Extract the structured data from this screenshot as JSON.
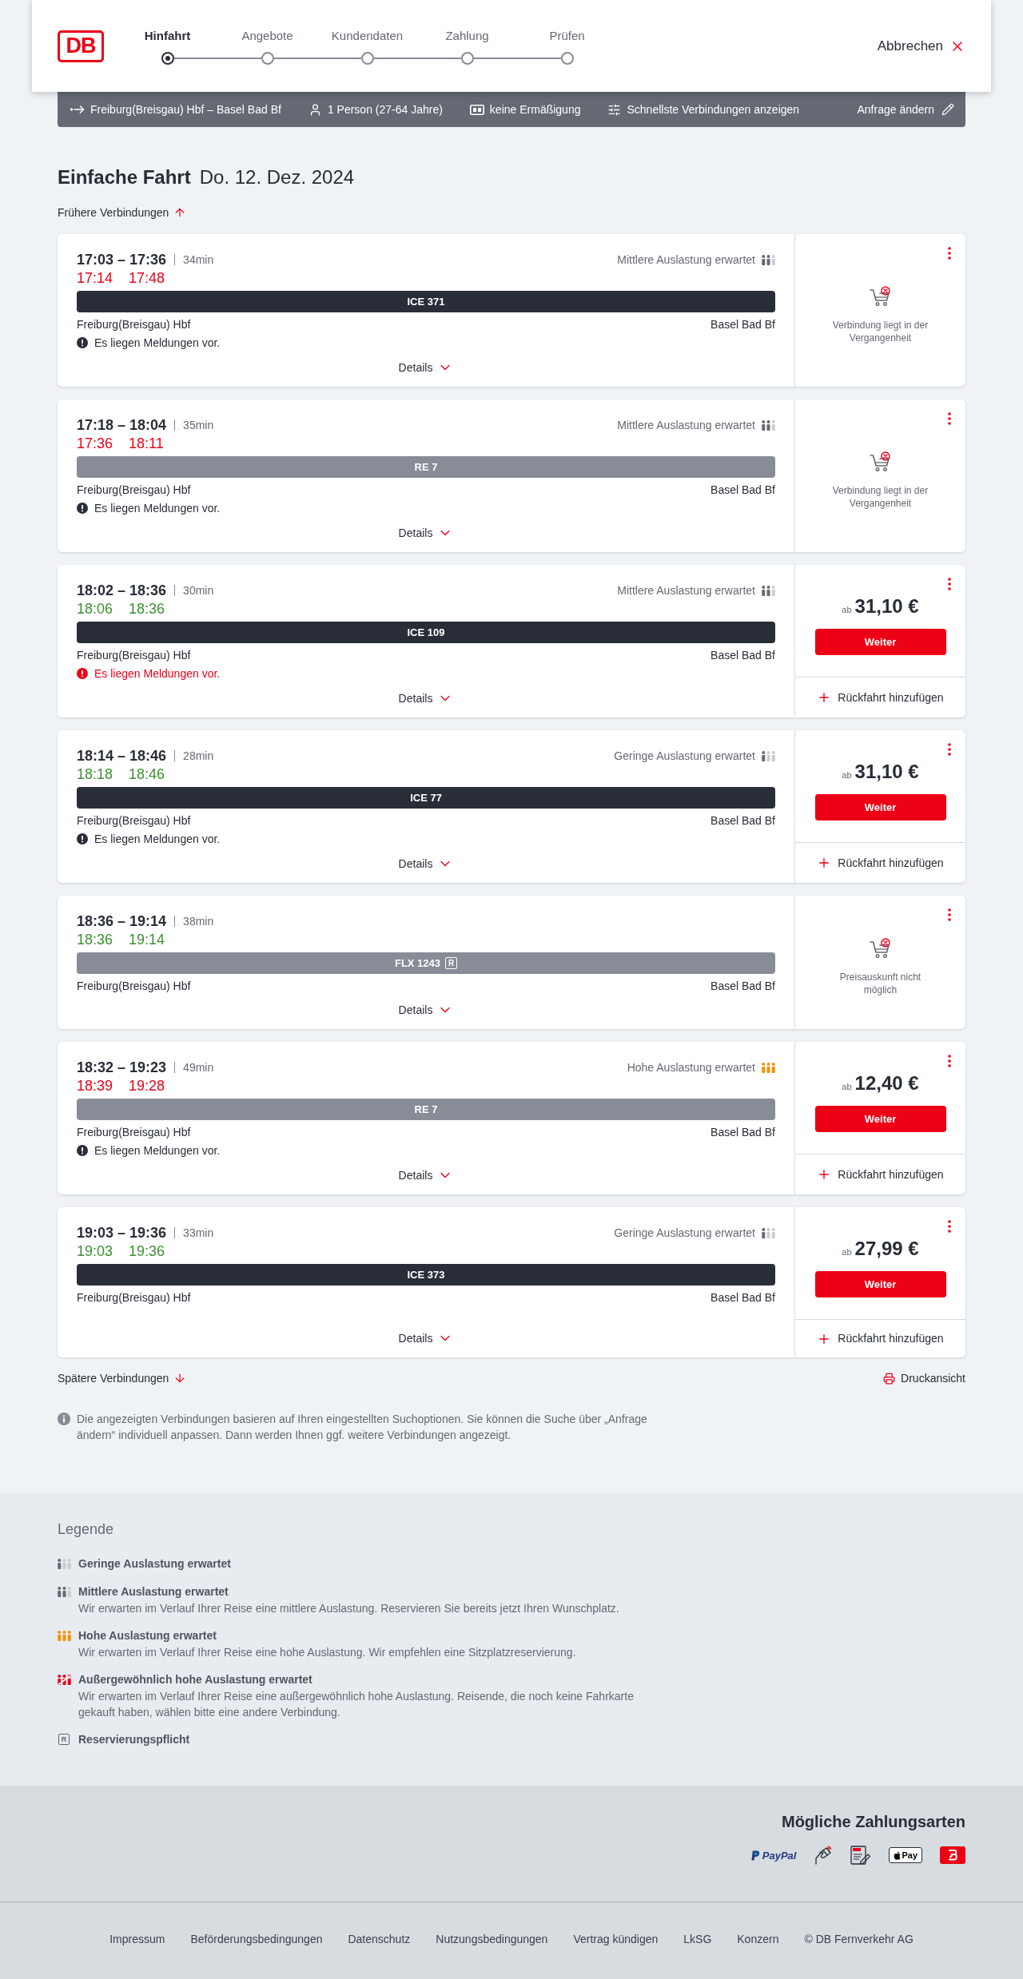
{
  "header": {
    "logo": "DB",
    "steps": [
      {
        "label": "Hinfahrt",
        "selected": true
      },
      {
        "label": "Angebote",
        "selected": false
      },
      {
        "label": "Kundendaten",
        "selected": false
      },
      {
        "label": "Zahlung",
        "selected": false
      },
      {
        "label": "Prüfen",
        "selected": false
      }
    ],
    "cancel": "Abbrechen"
  },
  "summary_bar": {
    "route": "Freiburg(Breisgau) Hbf – Basel Bad Bf",
    "travellers": "1 Person (27-64 Jahre)",
    "discount": "keine Ermäßigung",
    "search_option": "Schnellste Verbindungen anzeigen",
    "edit": "Anfrage ändern"
  },
  "heading": {
    "trip_type": "Einfache Fahrt",
    "date": "Do. 12. Dez. 2024"
  },
  "earlier_link": "Frühere Verbindungen",
  "connections": [
    {
      "times": "17:03 – 17:36",
      "duration": "34min",
      "realtime": {
        "departure": "17:14",
        "arrival": "17:48",
        "punctual": false
      },
      "occupancy": {
        "kind": "medium",
        "label": "Mittlere Auslastung erwartet"
      },
      "train": {
        "name": "ICE 371",
        "kind": "ice"
      },
      "from": "Freiburg(Breisgau) Hbf",
      "to": "Basel Bad Bf",
      "message": {
        "text": "Es liegen Meldungen vor.",
        "kind": "info"
      },
      "details": "Details",
      "offer": {
        "kind": "unavailable",
        "text": "Verbindung liegt in der Vergangenheit"
      }
    },
    {
      "times": "17:18 – 18:04",
      "duration": "35min",
      "realtime": {
        "departure": "17:36",
        "arrival": "18:11",
        "punctual": false
      },
      "occupancy": {
        "kind": "medium",
        "label": "Mittlere Auslastung erwartet"
      },
      "train": {
        "name": "RE 7",
        "kind": "regional"
      },
      "from": "Freiburg(Breisgau) Hbf",
      "to": "Basel Bad Bf",
      "message": {
        "text": "Es liegen Meldungen vor.",
        "kind": "info"
      },
      "details": "Details",
      "offer": {
        "kind": "unavailable",
        "text": "Verbindung liegt in der Vergangenheit"
      }
    },
    {
      "times": "18:02 – 18:36",
      "duration": "30min",
      "realtime": {
        "departure": "18:06",
        "arrival": "18:36",
        "punctual": true
      },
      "occupancy": {
        "kind": "medium",
        "label": "Mittlere Auslastung erwartet"
      },
      "train": {
        "name": "ICE 109",
        "kind": "ice"
      },
      "from": "Freiburg(Breisgau) Hbf",
      "to": "Basel Bad Bf",
      "message": {
        "text": "Es liegen Meldungen vor.",
        "kind": "warning"
      },
      "details": "Details",
      "offer": {
        "kind": "price",
        "prefix": "ab",
        "amount": "31,10 €",
        "button": "Weiter",
        "return_trip": "Rückfahrt hinzufügen"
      }
    },
    {
      "times": "18:14 – 18:46",
      "duration": "28min",
      "realtime": {
        "departure": "18:18",
        "arrival": "18:46",
        "punctual": true
      },
      "occupancy": {
        "kind": "low",
        "label": "Geringe Auslastung erwartet"
      },
      "train": {
        "name": "ICE 77",
        "kind": "ice"
      },
      "from": "Freiburg(Breisgau) Hbf",
      "to": "Basel Bad Bf",
      "message": {
        "text": "Es liegen Meldungen vor.",
        "kind": "info"
      },
      "details": "Details",
      "offer": {
        "kind": "price",
        "prefix": "ab",
        "amount": "31,10 €",
        "button": "Weiter",
        "return_trip": "Rückfahrt hinzufügen"
      }
    },
    {
      "times": "18:36 – 19:14",
      "duration": "38min",
      "realtime": {
        "departure": "18:36",
        "arrival": "19:14",
        "punctual": true
      },
      "train": {
        "name": "FLX 1243",
        "kind": "flx",
        "reservation_mark": "R"
      },
      "from": "Freiburg(Breisgau) Hbf",
      "to": "Basel Bad Bf",
      "details": "Details",
      "offer": {
        "kind": "unavailable",
        "text": "Preisauskunft nicht möglich"
      }
    },
    {
      "times": "18:32 – 19:23",
      "duration": "49min",
      "realtime": {
        "departure": "18:39",
        "arrival": "19:28",
        "punctual": false
      },
      "occupancy": {
        "kind": "high",
        "label": "Hohe Auslastung erwartet"
      },
      "train": {
        "name": "RE 7",
        "kind": "regional"
      },
      "from": "Freiburg(Breisgau) Hbf",
      "to": "Basel Bad Bf",
      "message": {
        "text": "Es liegen Meldungen vor.",
        "kind": "info"
      },
      "details": "Details",
      "offer": {
        "kind": "price",
        "prefix": "ab",
        "amount": "12,40 €",
        "button": "Weiter",
        "return_trip": "Rückfahrt hinzufügen"
      }
    },
    {
      "times": "19:03 – 19:36",
      "duration": "33min",
      "realtime": {
        "departure": "19:03",
        "arrival": "19:36",
        "punctual": true
      },
      "occupancy": {
        "kind": "low",
        "label": "Geringe Auslastung erwartet"
      },
      "train": {
        "name": "ICE 373",
        "kind": "ice"
      },
      "from": "Freiburg(Breisgau) Hbf",
      "to": "Basel Bad Bf",
      "details": "Details",
      "offer": {
        "kind": "price",
        "prefix": "ab",
        "amount": "27,99 €",
        "button": "Weiter",
        "return_trip": "Rückfahrt hinzufügen"
      }
    }
  ],
  "later_link": "Spätere Verbindungen",
  "print_link": "Druckansicht",
  "note": "Die angezeigten Verbindungen basieren auf Ihren eingestellten Suchoptionen. Sie können die Suche über „Anfrage ändern“ individuell anpassen. Dann werden Ihnen ggf. weitere Verbindungen angezeigt.",
  "legend": {
    "title": "Legende",
    "items": [
      {
        "kind": "low",
        "title": "Geringe Auslastung erwartet"
      },
      {
        "kind": "medium",
        "title": "Mittlere Auslastung erwartet",
        "description": "Wir erwarten im Verlauf Ihrer Reise eine mittlere Auslastung. Reservieren Sie bereits jetzt Ihren Wunschplatz."
      },
      {
        "kind": "high",
        "title": "Hohe Auslastung erwartet",
        "description": "Wir erwarten im Verlauf Ihrer Reise eine hohe Auslastung. Wir empfehlen eine Sitzplatzreservierung."
      },
      {
        "kind": "extreme",
        "title": "Außergewöhnlich hohe Auslastung erwartet",
        "description": "Wir erwarten im Verlauf Ihrer Reise eine außergewöhnlich hohe Auslastung. Reisende, die noch keine Fahrkarte gekauft haben, wählen bitte eine andere Verbindung."
      },
      {
        "kind": "reservation",
        "symbol": "R",
        "title": "Reservierungspflicht"
      }
    ]
  },
  "payment": {
    "title": "Mögliche Zahlungsarten",
    "methods": [
      {
        "kind": "paypal",
        "label": "PayPal"
      },
      {
        "kind": "card"
      },
      {
        "kind": "sepa"
      },
      {
        "kind": "applepay",
        "label": "Pay"
      },
      {
        "kind": "bonus"
      }
    ]
  },
  "footer": {
    "links": [
      "Impressum",
      "Beförderungsbedingungen",
      "Datenschutz",
      "Nutzungsbedingungen",
      "Vertrag kündigen",
      "LkSG",
      "Konzern",
      "© DB Fernverkehr AG"
    ]
  }
}
